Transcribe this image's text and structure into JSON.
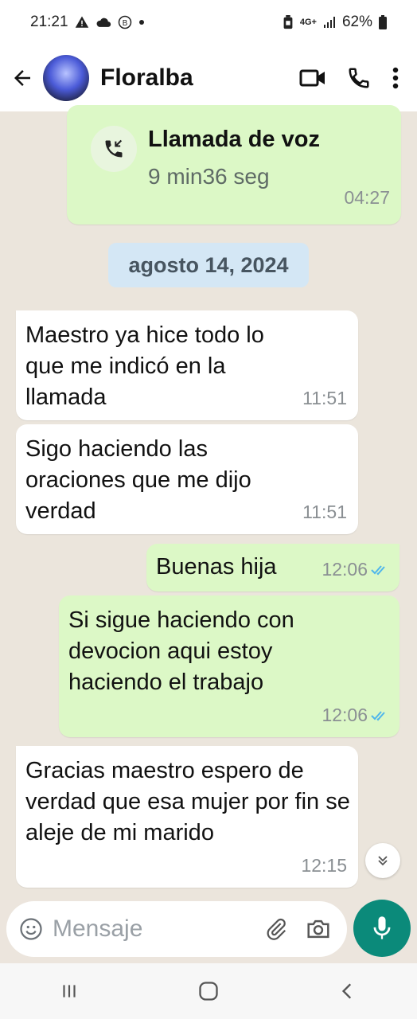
{
  "status_bar": {
    "time": "21:21",
    "battery": "62%",
    "network": "4G+",
    "icons": [
      "warning-icon",
      "cloud-icon",
      "b-circle-icon",
      "dot-icon",
      "battery-saver-icon",
      "signal-icon",
      "battery-icon"
    ]
  },
  "header": {
    "contact_name": "Floralba",
    "icons": [
      "back-arrow-icon",
      "avatar",
      "video-call-icon",
      "phone-icon",
      "more-vert-icon"
    ]
  },
  "call_card": {
    "title": "Llamada de voz",
    "duration": "9 min36 seg",
    "time": "04:27",
    "icon": "incoming-call-icon"
  },
  "date_chip": "agosto 14, 2024",
  "messages": [
    {
      "direction": "in",
      "text": "Maestro ya hice todo lo que me indicó en la llamada",
      "time": "11:51"
    },
    {
      "direction": "in",
      "text": "Sigo haciendo las oraciones que me dijo verdad",
      "time": "11:51"
    },
    {
      "direction": "out",
      "text": "Buenas hija",
      "time": "12:06",
      "status": "read"
    },
    {
      "direction": "out",
      "text": "Si sigue haciendo con devocion aqui estoy haciendo el trabajo",
      "time": "12:06",
      "status": "read"
    },
    {
      "direction": "in",
      "text": "Gracias maestro espero de verdad que esa mujer por fin se aleje de mi marido",
      "time": "12:15"
    }
  ],
  "composer": {
    "placeholder": "Mensaje",
    "icons": [
      "emoji-icon",
      "attach-icon",
      "camera-icon",
      "mic-icon"
    ]
  },
  "colors": {
    "incoming": "#ffffff",
    "outgoing": "#dcf8c6",
    "accent": "#0b8a7a",
    "read_check": "#4fb6ec"
  }
}
